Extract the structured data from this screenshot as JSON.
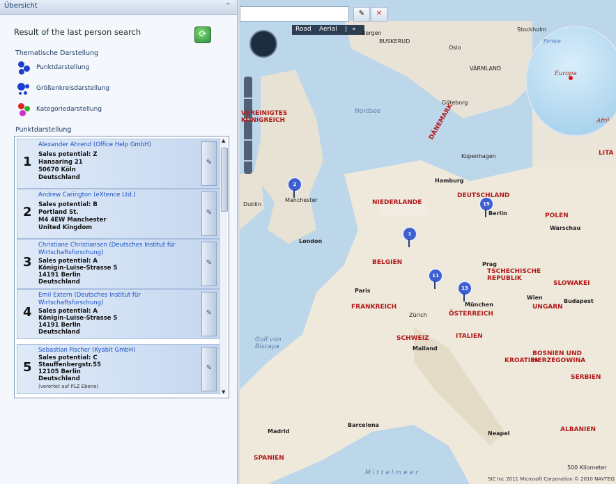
{
  "panel": {
    "title": "Übersicht",
    "result_title": "Result of the last person search",
    "thematic_title": "Thematische Darstellung",
    "viz_items": [
      {
        "label": "Punktdarstellung",
        "icon": "dot-chart-icon"
      },
      {
        "label": "Größenkreisdarstellung",
        "icon": "bubble-chart-icon"
      },
      {
        "label": "Kategoriedarstellung",
        "icon": "category-chart-icon"
      }
    ],
    "list_title": "Punktdarstellung",
    "items": [
      {
        "num": "1",
        "name": "Alexander Ahrend (Office Help GmbH)",
        "lines": [
          "Sales potential: Z",
          "Hansaring 21",
          "50670 Köln",
          "Deutschland"
        ]
      },
      {
        "num": "2",
        "name": "Andrew Carington (eXtence Ltd.)",
        "lines": [
          "Sales potential: B",
          "Portland St.",
          "M4 4EW Manchester",
          "United Kingdom"
        ]
      },
      {
        "num": "3",
        "name": "Christiane Christiansen (Deutsches Institut für Wirtschaftsforschung)",
        "lines": [
          "Sales potential: A",
          "Königin-Luise-Strasse 5",
          "14191 Berlin",
          "Deutschland"
        ]
      },
      {
        "num": "4",
        "name": "Emil Extern (Deutsches Institut für Wirtschaftsforschung)",
        "lines": [
          "Sales potential: A",
          "Königin-Luise-Strasse 5",
          "14191 Berlin",
          "Deutschland"
        ]
      },
      {
        "num": "5",
        "name": "Sebastian Fischer (Kyabit GmbH)",
        "lines": [
          "Sales potential: C",
          "Stauffenbergstr.55",
          "12105 Berlin",
          "Deutschland"
        ],
        "note": "(verortet auf PLZ Ebene)"
      }
    ]
  },
  "map": {
    "view_road": "Road",
    "view_aerial": "Aerial",
    "view_separator": "|",
    "collapse_label": "«",
    "pins": [
      "2",
      "15",
      "1",
      "11",
      "13"
    ],
    "labels": [
      {
        "text": "Bergen",
        "type": "city"
      },
      {
        "text": "BUSKERUD",
        "type": "region"
      },
      {
        "text": "Oslo",
        "type": "city"
      },
      {
        "text": "VÄRMLAND",
        "type": "region"
      },
      {
        "text": "Göteborg",
        "type": "city"
      },
      {
        "text": "Nordsee",
        "type": "sea"
      },
      {
        "text": "DEUTSCHLAND",
        "type": "country"
      },
      {
        "text": "NIEDERLANDE",
        "type": "country"
      },
      {
        "text": "BELGIEN",
        "type": "country"
      },
      {
        "text": "FRANKREICH",
        "type": "country"
      },
      {
        "text": "SCHWEIZ",
        "type": "country"
      },
      {
        "text": "ÖSTERREICH",
        "type": "country"
      },
      {
        "text": "ITALIEN",
        "type": "country"
      },
      {
        "text": "TSCHECHISCHE REPUBLIK",
        "type": "country"
      },
      {
        "text": "POLEN",
        "type": "country"
      },
      {
        "text": "UNGARN",
        "type": "country"
      },
      {
        "text": "KROATIEN",
        "type": "country"
      },
      {
        "text": "BOSNIEN UND HERZEGOWINA",
        "type": "country"
      },
      {
        "text": "SERBIEN",
        "type": "country"
      },
      {
        "text": "SLOWAKEI",
        "type": "country"
      },
      {
        "text": "LITA",
        "type": "country"
      },
      {
        "text": "DÄNEMARK",
        "type": "country"
      },
      {
        "text": "VEREINIGTES KÖNIGREICH",
        "type": "country"
      },
      {
        "text": "SPANIEN",
        "type": "country"
      },
      {
        "text": "ALBANIEN",
        "type": "country"
      },
      {
        "text": "London",
        "type": "city"
      },
      {
        "text": "Paris",
        "type": "city"
      },
      {
        "text": "Berlin",
        "type": "city"
      },
      {
        "text": "Hamburg",
        "type": "city"
      },
      {
        "text": "München",
        "type": "city"
      },
      {
        "text": "Wien",
        "type": "city"
      },
      {
        "text": "Prag",
        "type": "city"
      },
      {
        "text": "Warschau",
        "type": "city"
      },
      {
        "text": "Manchester",
        "type": "city"
      },
      {
        "text": "Dublin",
        "type": "city"
      },
      {
        "text": "Zürich",
        "type": "city"
      },
      {
        "text": "Mailand",
        "type": "city"
      },
      {
        "text": "Barcelona",
        "type": "city"
      },
      {
        "text": "Madrid",
        "type": "city"
      },
      {
        "text": "Neapel",
        "type": "city"
      },
      {
        "text": "Budapest",
        "type": "city"
      },
      {
        "text": "Stockholm",
        "type": "city"
      },
      {
        "text": "Kopenhagen",
        "type": "city"
      },
      {
        "text": "Mittelmeer",
        "type": "sea"
      },
      {
        "text": "Golf von Biscaya",
        "type": "sea"
      },
      {
        "text": "Europäisches Nordmeer",
        "type": "sea"
      },
      {
        "text": "Europa",
        "type": "region"
      },
      {
        "text": "Afrika",
        "type": "region"
      }
    ],
    "scale": "500 Kilometer",
    "copyright": "SIC Inc 2011 Microsoft Corporation  © 2010 NAVTEQ"
  }
}
